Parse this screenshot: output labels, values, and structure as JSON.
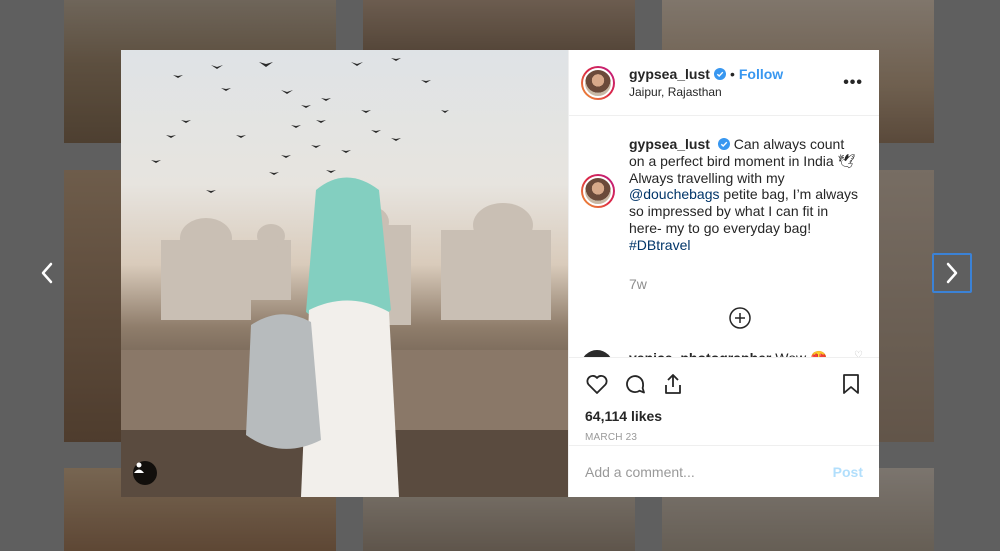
{
  "post": {
    "username": "gypsea_lust",
    "follow_label": "Follow",
    "dot": "•",
    "location": "Jaipur, Rajasthan",
    "more_label": "•••",
    "caption_prefix": "Can always count on a perfect bird moment in India 🕊  Always travelling with my ",
    "caption_mention": "@douchebags",
    "caption_middle": " petite bag, I’m always so impressed by what I can fit in here- my to go everyday bag! ",
    "caption_hashtag": "#DBtravel",
    "time_ago": "7w",
    "likes": "64,114 likes",
    "date": "MARCH 23",
    "comment_placeholder": "Add a comment...",
    "post_label": "Post"
  },
  "comments": [
    {
      "username": "venice_photographer",
      "text": "Wow 😍"
    }
  ],
  "icons": {
    "prev": "chevron-left-icon",
    "next": "chevron-right-icon",
    "verified": "verified-badge-icon",
    "load_more": "plus-circle-icon",
    "like": "heart-icon",
    "comment": "comment-bubble-icon",
    "share": "share-icon",
    "save": "bookmark-icon",
    "tag": "user-tag-icon"
  },
  "colors": {
    "accent": "#3897f0",
    "verified": "#3897f0",
    "focus_outline": "#3b82d6",
    "post_disabled": "#b2dffc"
  }
}
